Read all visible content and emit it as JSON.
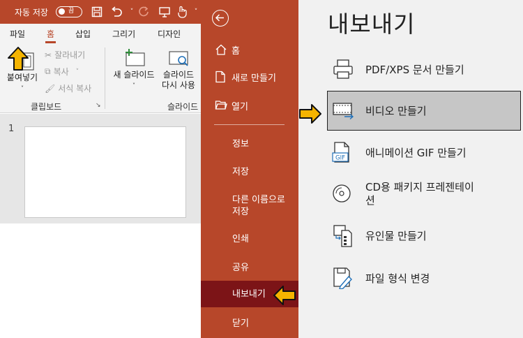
{
  "titlebar": {
    "autosave_label": "자동 저장",
    "toggle_state": "끔"
  },
  "tabs": [
    "파일",
    "홈",
    "삽입",
    "그리기",
    "디자인"
  ],
  "ribbon": {
    "paste": "붙여넣기",
    "cut": "잘라내기",
    "copy": "복사",
    "format_painter": "서식 복사",
    "new_slide": "새 슬라이드",
    "reuse_slide_line1": "슬라이드",
    "reuse_slide_line2": "다시 사용",
    "group_clipboard": "클립보드",
    "group_slides": "슬라이드"
  },
  "slide_panel": {
    "slide_number": "1"
  },
  "nav": {
    "home": "홈",
    "new": "새로 만들기",
    "open": "열기",
    "info": "정보",
    "save": "저장",
    "save_as_line1": "다른 이름으로",
    "save_as_line2": "저장",
    "print": "인쇄",
    "share": "공유",
    "export": "내보내기",
    "close": "닫기"
  },
  "panel": {
    "title": "내보내기",
    "options": {
      "pdf": "PDF/XPS 문서 만들기",
      "video": "비디오 만들기",
      "gif": "애니메이션 GIF 만들기",
      "cd_line1": "CD용 패키지 프레젠테이",
      "cd_line2": "션",
      "handouts": "유인물 만들기",
      "change_type": "파일 형식 변경"
    }
  },
  "colors": {
    "accent": "#b7472a",
    "nav_selected": "#7c1417",
    "highlight_arrow": "#f5b400"
  }
}
